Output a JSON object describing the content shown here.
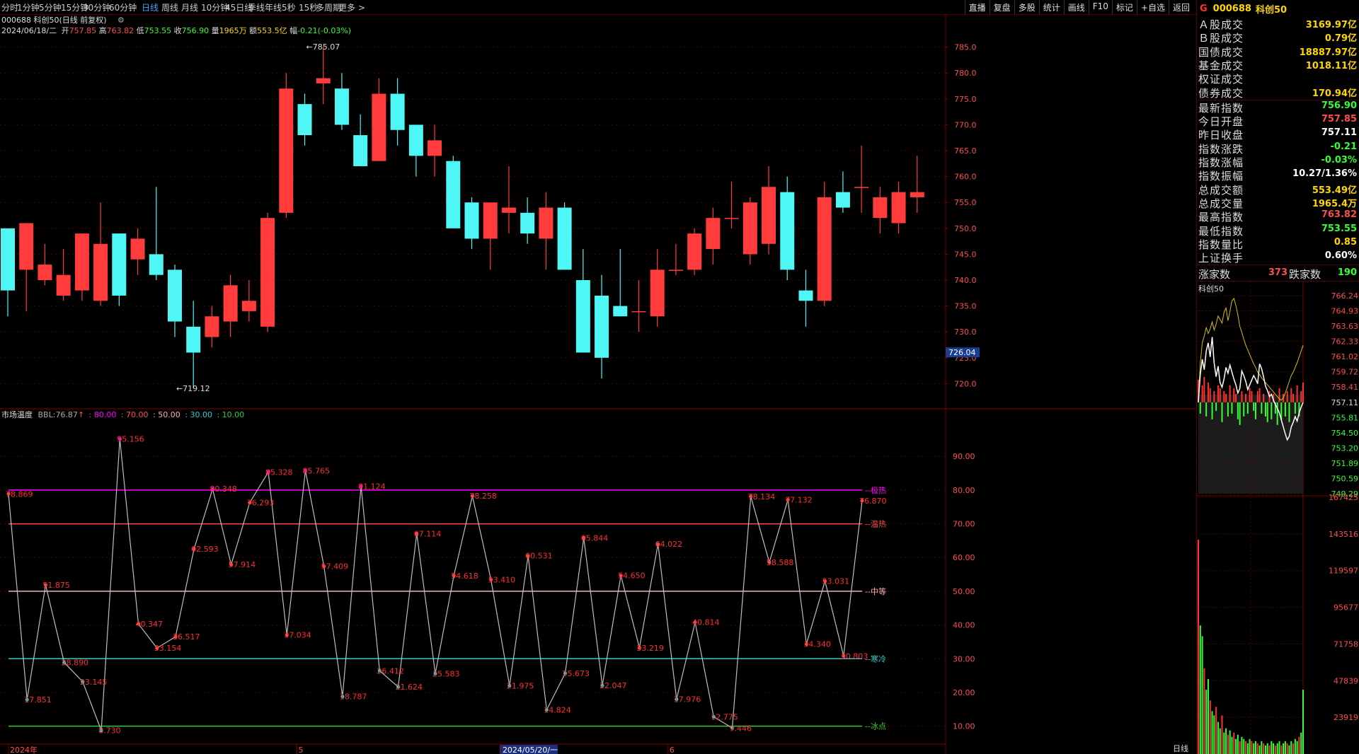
{
  "period_tabs": [
    {
      "label": "分时"
    },
    {
      "label": "1分钟"
    },
    {
      "label": "5分钟"
    },
    {
      "label": "15分钟"
    },
    {
      "label": "30分钟"
    },
    {
      "label": "60分钟"
    },
    {
      "label": "日线",
      "active": true
    },
    {
      "label": "周线"
    },
    {
      "label": "月线"
    },
    {
      "label": "10分钟"
    },
    {
      "label": "45日线"
    },
    {
      "label": "季线"
    },
    {
      "label": "年线"
    },
    {
      "label": "5秒"
    },
    {
      "label": "15秒"
    },
    {
      "label": "多周期"
    },
    {
      "label": "更多 >"
    }
  ],
  "toolbar": [
    {
      "label": "直播"
    },
    {
      "label": "复盘"
    },
    {
      "label": "多股"
    },
    {
      "label": "统计"
    },
    {
      "label": "画线"
    },
    {
      "label": "F10"
    },
    {
      "label": "标记"
    },
    {
      "label": "+自选"
    },
    {
      "label": "返回"
    }
  ],
  "chart_header": {
    "title": "000688 科创50(日线 前复权)",
    "gear_icon": "gear-icon"
  },
  "ohlc_info": {
    "date": "2024/06/18/二",
    "open_label": "开",
    "open": "757.85",
    "high_label": "高",
    "high": "763.82",
    "low_label": "低",
    "low": "753.55",
    "close_label": "收",
    "close": "756.90",
    "vol_label": "量",
    "vol": "1965万",
    "amt_label": "额",
    "amt": "553.5亿",
    "chg_label": "幅",
    "chg": "-0.21(-0.03%)"
  },
  "chart_data": [
    {
      "name": "main-candles",
      "type": "candlestick",
      "ylim": [
        716.5,
        787
      ],
      "y_ticks": [
        720,
        725,
        730,
        735,
        740,
        745,
        750,
        755,
        760,
        765,
        770,
        775,
        780,
        785
      ],
      "y_tick_labels": [
        "720.0",
        "725.0",
        "730.0",
        "735.0",
        "740.0",
        "745.0",
        "750.0",
        "755.0",
        "760.0",
        "765.0",
        "770.0",
        "775.0",
        "780.0",
        "785.0"
      ],
      "cursor_price": "726.04",
      "annotations": [
        {
          "label": "785.07",
          "candle": 16,
          "value": 785.07
        },
        {
          "label": "719.12",
          "candle": 9,
          "value": 719.12
        }
      ],
      "x_labels": [
        {
          "label": "2024年",
          "candle": 0
        },
        {
          "label": "5",
          "candle": 16
        },
        {
          "label": "2024/05/20/一",
          "candle": 27,
          "highlight": true
        },
        {
          "label": "6",
          "candle": 36
        }
      ],
      "ohlc": [
        [
          750,
          738,
          749,
          733
        ],
        [
          742,
          751,
          743,
          734
        ],
        [
          740,
          743,
          747,
          739
        ],
        [
          737,
          741,
          746,
          736
        ],
        [
          738,
          749,
          749,
          736
        ],
        [
          736,
          747,
          755,
          735
        ],
        [
          749,
          737,
          749,
          735
        ],
        [
          744,
          748,
          750,
          741
        ],
        [
          745,
          741,
          758,
          740
        ],
        [
          742,
          732,
          743,
          729
        ],
        [
          731,
          726,
          736,
          719.12
        ],
        [
          729,
          733,
          735,
          727
        ],
        [
          732,
          739,
          741,
          729
        ],
        [
          734,
          736,
          740,
          732
        ],
        [
          731,
          752,
          753,
          730
        ],
        [
          753,
          777,
          780,
          752
        ],
        [
          774,
          768,
          776,
          766
        ],
        [
          778,
          779,
          785.07,
          774
        ],
        [
          777,
          770,
          780,
          769
        ],
        [
          768,
          762,
          772,
          762
        ],
        [
          763,
          776,
          779,
          763
        ],
        [
          776,
          769,
          779,
          766
        ],
        [
          770,
          764,
          770,
          760
        ],
        [
          764,
          767,
          770,
          760
        ],
        [
          763,
          750,
          764,
          750
        ],
        [
          755,
          748,
          756,
          746
        ],
        [
          748,
          755,
          755,
          742
        ],
        [
          753,
          754,
          762,
          749
        ],
        [
          753,
          749,
          756,
          747
        ],
        [
          748,
          754,
          757,
          742
        ],
        [
          754,
          742,
          755,
          742
        ],
        [
          740,
          726,
          746,
          726
        ],
        [
          737,
          725,
          741,
          721
        ],
        [
          735,
          733,
          746,
          733
        ],
        [
          734,
          734,
          740,
          730
        ],
        [
          733,
          742,
          746,
          731
        ],
        [
          742,
          742,
          747,
          741
        ],
        [
          742,
          749,
          750,
          741
        ],
        [
          746,
          752,
          754,
          743
        ],
        [
          752,
          752,
          759,
          750
        ],
        [
          745,
          755,
          756,
          743
        ],
        [
          747,
          758,
          762,
          745
        ],
        [
          757,
          742,
          760,
          740
        ],
        [
          738,
          736,
          742,
          731
        ],
        [
          736,
          756,
          759,
          735
        ],
        [
          757,
          754,
          761,
          753
        ],
        [
          758,
          758,
          766,
          753
        ],
        [
          752,
          756,
          758,
          749
        ],
        [
          751,
          757,
          759,
          749
        ],
        [
          756,
          757,
          764,
          753
        ]
      ]
    },
    {
      "name": "market-temperature",
      "type": "line",
      "ylim": [
        3,
        102
      ],
      "y_ticks": [
        10,
        20,
        30,
        40,
        50,
        60,
        70,
        80,
        90
      ],
      "y_tick_labels": [
        "10.00",
        "20.00",
        "30.00",
        "40.00",
        "50.00",
        "60.00",
        "70.00",
        "80.00",
        "90.00"
      ],
      "ref_lines": [
        {
          "value": 80,
          "label": "极热",
          "color": "#ff00ff"
        },
        {
          "value": 70,
          "label": "温热",
          "color": "#ff4d4d"
        },
        {
          "value": 50,
          "label": "中等",
          "color": "#ffb0b0"
        },
        {
          "value": 30,
          "label": "寒冷",
          "color": "#33cccc"
        },
        {
          "value": 10,
          "label": "冰点",
          "color": "#33cc33"
        }
      ],
      "values": [
        78.869,
        17.851,
        51.875,
        28.89,
        23.145,
        8.73,
        95.156,
        40.347,
        33.154,
        36.517,
        62.593,
        80.348,
        57.914,
        76.293,
        85.328,
        37.034,
        85.765,
        57.409,
        18.787,
        81.124,
        26.412,
        21.624,
        67.114,
        25.583,
        54.618,
        78.258,
        53.41,
        21.975,
        60.531,
        14.824,
        25.673,
        65.844,
        22.047,
        54.65,
        33.219,
        64.022,
        17.976,
        40.814,
        12.775,
        9.446,
        78.134,
        58.588,
        77.132,
        34.34,
        53.031,
        30.803,
        76.87
      ],
      "labels": [
        "78.869",
        "17.851",
        "51.875",
        "28.890",
        "23.145",
        "8.730",
        "95.156",
        "40.347",
        "33.154",
        "36.517",
        "62.593",
        "80.348",
        "57.914",
        "76.293",
        "85.328",
        "37.034",
        "85.765",
        "57.409",
        "18.787",
        "81.124",
        "26.412",
        "21.624",
        "67.114",
        "25.583",
        "54.618",
        "78.258",
        "53.410",
        "21.975",
        "60.531",
        "14.824",
        "25.673",
        "65.844",
        "22.047",
        "54.650",
        "33.219",
        "64.022",
        "17.976",
        "40.814",
        "12.775",
        "9.446",
        "78.134",
        "58.588",
        "77.132",
        "34.340",
        "53.031",
        "30.803",
        "76.870"
      ]
    },
    {
      "name": "intraday-mini",
      "type": "line",
      "y_ticks_price": [
        "766.24",
        "764.93",
        "763.63",
        "762.33",
        "761.02",
        "759.72",
        "758.41",
        "757.11",
        "755.81",
        "754.50",
        "753.20",
        "751.89",
        "750.59",
        "749.29"
      ],
      "y_ticks_volume": [
        "167425",
        "143516",
        "119597",
        "95677",
        "71758",
        "47839",
        "23919"
      ],
      "index_line": [
        757.11,
        759.5,
        760.8,
        759.9,
        761.5,
        762.2,
        761.0,
        762.7,
        760.5,
        759.3,
        760.2,
        758.8,
        758.4,
        759.1,
        760.1,
        759.6,
        760.3,
        759.7,
        759.1,
        758.6,
        757.9,
        758.3,
        759.8,
        759.4,
        758.9,
        758.2,
        758.6,
        759.0,
        759.4,
        759.1,
        758.7,
        760.4,
        760.0,
        759.3,
        758.5,
        758.1,
        757.6,
        757.8,
        757.3,
        756.9,
        756.6,
        756.2,
        755.6,
        755.0,
        754.4,
        753.9,
        754.2,
        755.0,
        755.4,
        755.9,
        755.5,
        756.2,
        756.7,
        757.1
      ],
      "avg_line": [
        757.11,
        760.5,
        762.2,
        762.8,
        763.5,
        763.0,
        763.4,
        764.0,
        763.3,
        763.8,
        764.5,
        764.2,
        763.9,
        764.8,
        765.2,
        764.1,
        764.9,
        765.8,
        766.0,
        765.4,
        764.6,
        763.6,
        763.1,
        762.5,
        762.0,
        761.6,
        761.2,
        760.8,
        760.4,
        760.1,
        759.7,
        759.5,
        759.2,
        759.0,
        758.8,
        758.6,
        758.4,
        758.2,
        758.0,
        757.8,
        757.6,
        757.4,
        757.3,
        757.5,
        757.9,
        758.4,
        758.9,
        759.4,
        759.7,
        760.1,
        760.5,
        761.0,
        761.5,
        762.0
      ],
      "bars_up_down": [
        0.8,
        -0.4,
        0.6,
        0.9,
        -0.5,
        0.7,
        0.5,
        -0.6,
        0.4,
        -0.3,
        0.6,
        0.5,
        -0.7,
        0.4,
        0.3,
        -0.5,
        0.6,
        -0.4,
        0.5,
        0.3,
        -0.6,
        -0.8,
        0.4,
        -0.5,
        0.3,
        -0.4,
        0.5,
        0.4,
        -0.3,
        -0.6,
        0.4,
        0.5,
        -0.4,
        0.3,
        -0.5,
        -0.7,
        0.4,
        -0.6,
        0.3,
        -0.4,
        -0.8,
        0.5,
        -0.6,
        0.3,
        -0.5,
        0.4,
        -0.7,
        0.5,
        0.3,
        -0.4,
        0.6,
        -0.5,
        0.4,
        0.7
      ],
      "volume": [
        1.0,
        0.6,
        0.55,
        0.4,
        0.3,
        0.35,
        0.25,
        0.2,
        0.18,
        0.22,
        0.15,
        0.12,
        0.18,
        0.1,
        0.12,
        0.09,
        0.11,
        0.08,
        0.1,
        0.07,
        0.09,
        0.06,
        0.08,
        0.07,
        0.06,
        0.05,
        0.07,
        0.06,
        0.05,
        0.06,
        0.05,
        0.04,
        0.06,
        0.05,
        0.04,
        0.05,
        0.04,
        0.06,
        0.05,
        0.04,
        0.05,
        0.06,
        0.04,
        0.05,
        0.06,
        0.05,
        0.04,
        0.06,
        0.05,
        0.07,
        0.06,
        0.08,
        0.1,
        0.3
      ]
    }
  ],
  "indicator_header": {
    "name": "市场温度",
    "bbl_label": "BBL:",
    "bbl_value": "76.87",
    "p80": ": 80.00",
    "p70": ": 70.00",
    "p50": ": 50.00",
    "p30": ": 30.00",
    "p10": ": 10.00"
  },
  "period_label": "日线",
  "right_panel": {
    "g_label": "G",
    "code": "000688",
    "name": "科创50",
    "rows": [
      {
        "label": "Ａ股成交",
        "value": "3169.97亿",
        "color": "#ffd700"
      },
      {
        "label": "Ｂ股成交",
        "value": "0.79亿",
        "color": "#ffd700"
      },
      {
        "label": "国债成交",
        "value": "18887.97亿",
        "color": "#ffd700"
      },
      {
        "label": "基金成交",
        "value": "1018.11亿",
        "color": "#ffd700"
      },
      {
        "label": "权证成交",
        "value": "",
        "color": "#ffd700"
      },
      {
        "label": "债券成交",
        "value": "170.94亿",
        "color": "#ffd700"
      },
      {
        "label": "最新指数",
        "value": "756.90",
        "color": "#33ff33"
      },
      {
        "label": "今日开盘",
        "value": "757.85",
        "color": "#ff4d4d"
      },
      {
        "label": "昨日收盘",
        "value": "757.11",
        "color": "#ffffff"
      },
      {
        "label": "指数涨跌",
        "value": "-0.21",
        "color": "#33ff33"
      },
      {
        "label": "指数涨幅",
        "value": "-0.03%",
        "color": "#33ff33"
      },
      {
        "label": "指数振幅",
        "value": "10.27/1.36%",
        "color": "#ffffff"
      },
      {
        "label": "总成交额",
        "value": "553.49亿",
        "color": "#ffd700"
      },
      {
        "label": "总成交量",
        "value": "1965.4万",
        "color": "#ffd700"
      },
      {
        "label": "最高指数",
        "value": "763.82",
        "color": "#ff4d4d"
      },
      {
        "label": "最低指数",
        "value": "753.55",
        "color": "#33ff33"
      },
      {
        "label": "指数量比",
        "value": "0.85",
        "color": "#ffd700"
      },
      {
        "label": "上证换手",
        "value": "0.60%",
        "color": "#ffffff"
      }
    ],
    "up_label": "涨家数",
    "up_count": "373",
    "down_label": "跌家数",
    "down_count": "190",
    "mini_title": "科创50"
  },
  "colors": {
    "up": "#ff3b3b",
    "down": "#4ef6f6",
    "grid": "#4a0000",
    "axis_text": "#ff4d4d"
  }
}
